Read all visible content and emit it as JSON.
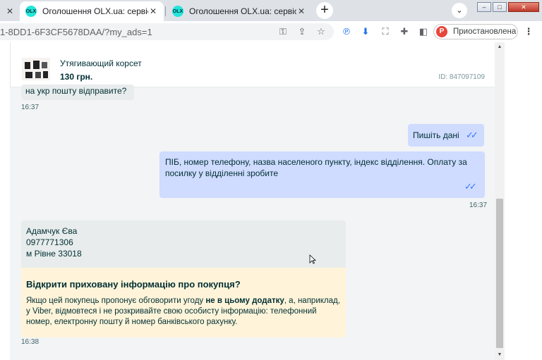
{
  "browser": {
    "tabs": [
      {
        "title": "Оголошення OLX.ua: сервіс огол",
        "favicon": "OLX"
      },
      {
        "title": "Оголошення OLX.ua: сервіс огол",
        "favicon": "OLX"
      }
    ],
    "close_glyph": "✕",
    "new_tab_glyph": "+",
    "url": "1-8DD1-6F3CF5678DAA/?my_ads=1",
    "profile": {
      "initial": "P",
      "label": "Приостановлена"
    }
  },
  "ad": {
    "title": "Утягивающий корсет",
    "price": "130 грн.",
    "id_label": "ID: 847097109"
  },
  "messages": {
    "incoming_partial": "на укр пошту відправите?",
    "time_1": "16:37",
    "outgoing_short": "Пишіть дані",
    "outgoing_long": "ПІБ, номер телефону, назва населеного пункту, індекс відділення. Оплату за посилку у відділенні зробите",
    "time_2": "16:37",
    "contact_lines": [
      "Адамчук Єва",
      "0977771306",
      "м Рівне 33018"
    ],
    "time_3": "16:38"
  },
  "warning": {
    "title": "Відкрити приховану інформацію про покупця?",
    "text_before": "Якщо цей покупець пропонує обговорити угоду ",
    "text_bold": "не в цьому додатку",
    "text_after": ", а, наприклад, у Viber, відмовтеся і не розкривайте свою особисту інформацію: телефонний номер, електронну пошту й номер банківського рахунку."
  },
  "colors": {
    "olx_teal": "#23e5db",
    "olx_dark": "#002f34",
    "outgoing_bubble": "#cfdbff",
    "warning_bg": "#fff4d9",
    "read_check": "#3a77ff"
  }
}
